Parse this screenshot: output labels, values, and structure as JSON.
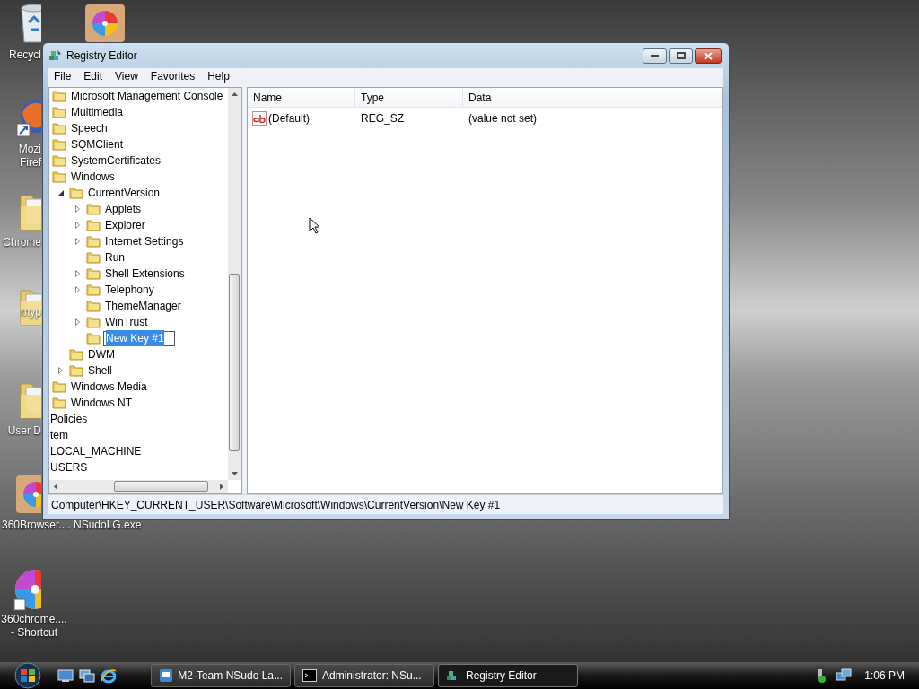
{
  "desktop_icons": [
    {
      "kind": "recycle-bin",
      "label": [
        "Recycl"
      ]
    },
    {
      "kind": "pinwheel-box"
    },
    {
      "kind": "firefox",
      "label": [
        "Mozi",
        "Firef"
      ]
    },
    {
      "kind": "folder",
      "label": [
        "Chrome"
      ]
    },
    {
      "kind": "folder",
      "label": [
        "myp"
      ]
    },
    {
      "kind": "folder",
      "label": [
        "User D"
      ]
    },
    {
      "kind": "pinwheel-box",
      "label": [
        "360Browser...."
      ]
    },
    {
      "kind": "none",
      "label": [
        "NSudoLG.exe"
      ]
    },
    {
      "kind": "pinwheel",
      "label": [
        "360chrome....",
        "- Shortcut"
      ]
    }
  ],
  "window": {
    "title": "Registry Editor"
  },
  "menu": [
    "File",
    "Edit",
    "View",
    "Favorites",
    "Help"
  ],
  "tree": [
    {
      "kind": "folder",
      "label": "Microsoft Management Console"
    },
    {
      "kind": "folder",
      "label": "Multimedia"
    },
    {
      "kind": "folder",
      "label": "Speech"
    },
    {
      "kind": "folder",
      "label": "SQMClient"
    },
    {
      "kind": "folder",
      "label": "SystemCertificates"
    },
    {
      "kind": "folder",
      "label": "Windows",
      "children": [
        {
          "kind": "folder",
          "label": "CurrentVersion",
          "expanded": true,
          "children": [
            {
              "kind": "folder",
              "label": "Applets",
              "expanded": false
            },
            {
              "kind": "folder",
              "label": "Explorer",
              "expanded": false
            },
            {
              "kind": "folder",
              "label": "Internet Settings",
              "expanded": false
            },
            {
              "kind": "folder",
              "label": "Run"
            },
            {
              "kind": "folder",
              "label": "Shell Extensions",
              "expanded": false
            },
            {
              "kind": "folder",
              "label": "Telephony",
              "expanded": false
            },
            {
              "kind": "folder",
              "label": "ThemeManager"
            },
            {
              "kind": "folder",
              "label": "WinTrust",
              "expanded": false
            },
            {
              "kind": "edit",
              "label": "New Key #1"
            }
          ]
        },
        {
          "kind": "folder",
          "label": "DWM"
        },
        {
          "kind": "folder",
          "label": "Shell",
          "expanded": false
        }
      ]
    },
    {
      "kind": "folder",
      "label": "Windows Media"
    },
    {
      "kind": "folder",
      "label": "Windows NT"
    },
    {
      "kind": "plain",
      "label": "Policies"
    },
    {
      "kind": "plain",
      "label": "tem"
    },
    {
      "kind": "plain",
      "label": "LOCAL_MACHINE"
    },
    {
      "kind": "plain",
      "label": "USERS"
    }
  ],
  "values": {
    "columns": [
      "Name",
      "Type",
      "Data"
    ],
    "rows": [
      {
        "name": "(Default)",
        "type": "REG_SZ",
        "data": "(value not set)"
      }
    ]
  },
  "status_bar": "Computer\\HKEY_CURRENT_USER\\Software\\Microsoft\\Windows\\CurrentVersion\\New Key #1",
  "taskbar": {
    "items": [
      {
        "kind": "nsudo",
        "label": "M2-Team NSudo La...",
        "selected": false
      },
      {
        "kind": "console",
        "label": "Administrator: NSu...",
        "selected": false
      },
      {
        "kind": "regedit",
        "label": "Registry Editor",
        "selected": true
      }
    ],
    "clock": "1:06 PM"
  }
}
